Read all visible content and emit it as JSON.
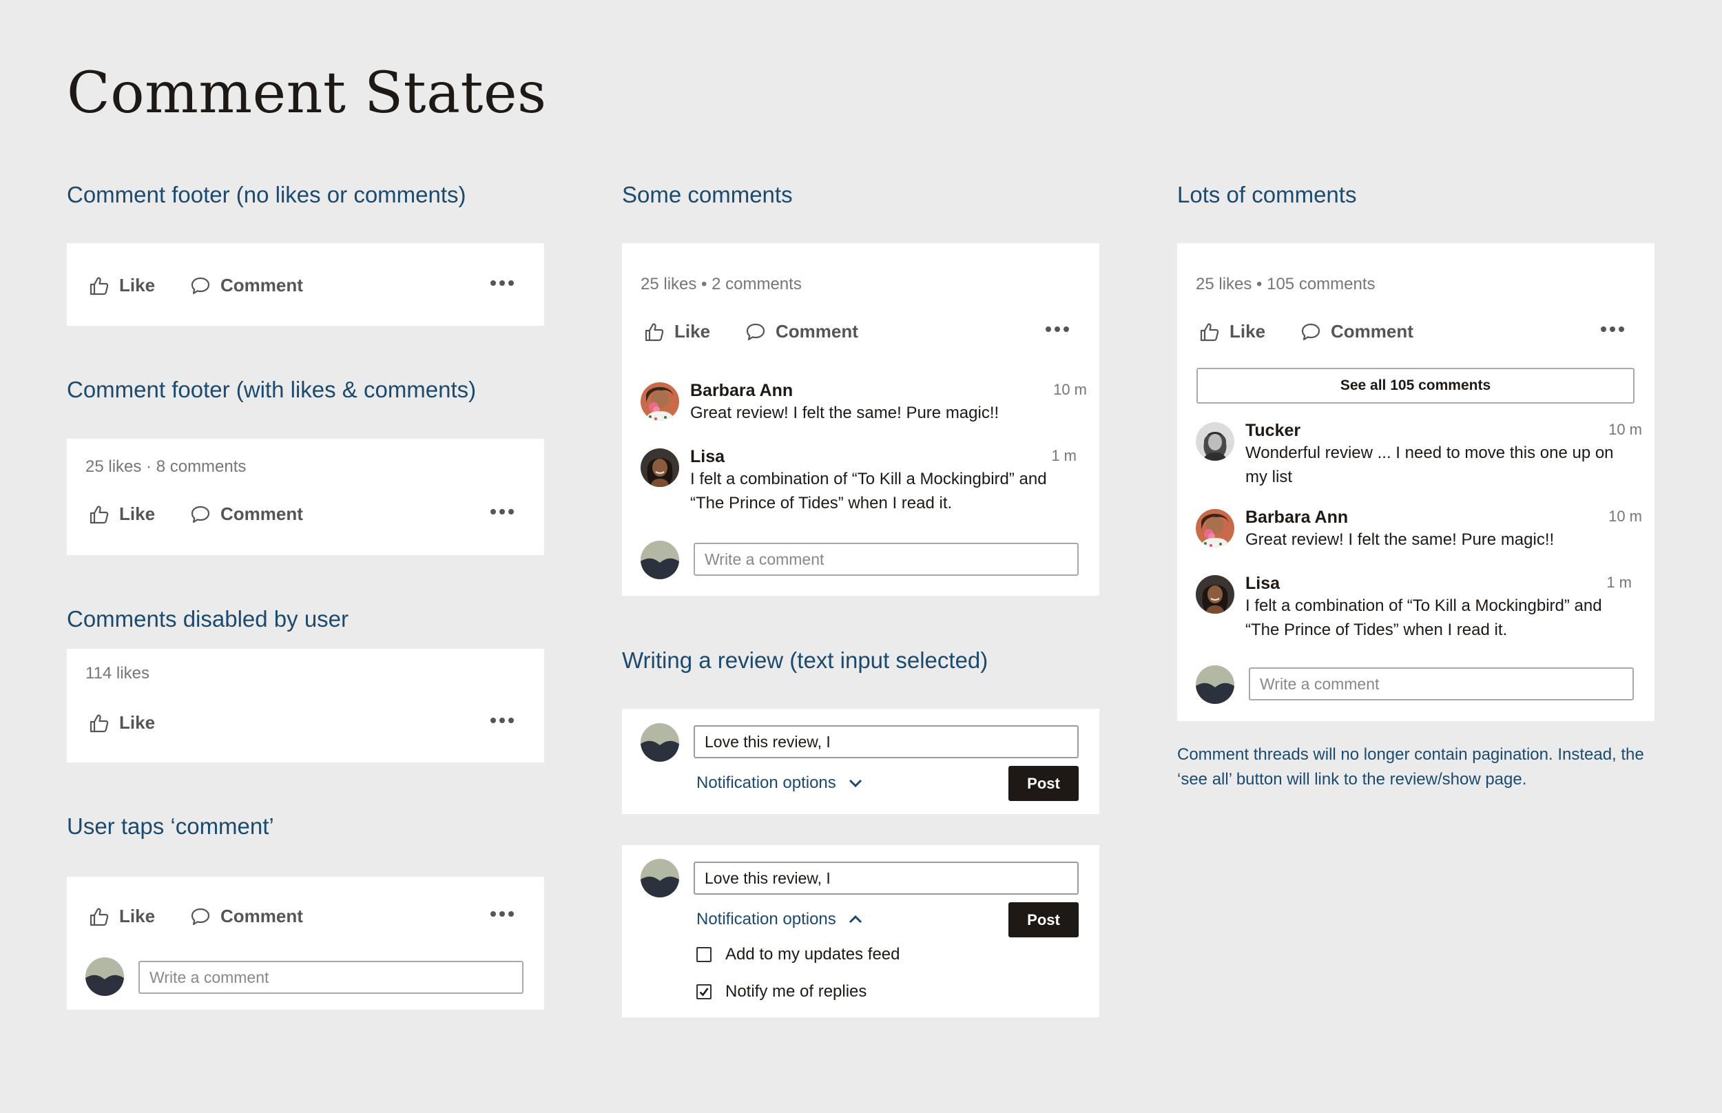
{
  "page": {
    "title": "Comment States"
  },
  "colors": {
    "background": "#ebebeb",
    "card": "#ffffff",
    "heading_blue": "#1c4a6e",
    "dark": "#1e1915",
    "muted": "#767676"
  },
  "icons": {
    "like": "thumbs-up-icon",
    "comment": "speech-bubble-icon",
    "more": "ellipsis-icon",
    "chevron_down": "chevron-down-icon",
    "chevron_up": "chevron-up-icon",
    "check": "checkmark-icon"
  },
  "actions": {
    "like_label": "Like",
    "comment_label": "Comment"
  },
  "input": {
    "placeholder": "Write a comment"
  },
  "sections": {
    "footer_empty": {
      "title": "Comment footer (no likes or comments)"
    },
    "footer_with": {
      "title": "Comment footer (with likes & comments)",
      "stats": "25 likes · 8 comments"
    },
    "disabled": {
      "title": "Comments disabled by user",
      "stats": "114 likes"
    },
    "taps_comment": {
      "title": "User taps ‘comment’"
    },
    "some": {
      "title": "Some comments",
      "stats": "25 likes • 2 comments",
      "comments": [
        {
          "name": "Barbara Ann",
          "time": "10 m",
          "text": "Great review! I felt the same! Pure magic!!"
        },
        {
          "name": "Lisa",
          "time": "1 m",
          "text": "I felt a combination of “To Kill a Mockingbird” and “The Prince of Tides” when I read it."
        }
      ]
    },
    "writing": {
      "title": "Writing a review (text input selected)",
      "input_value": "Love this review, I",
      "notification_label": "Notification options",
      "post_label": "Post",
      "options": [
        {
          "label": "Add to my updates feed",
          "checked": false
        },
        {
          "label": "Notify me of replies",
          "checked": true
        }
      ]
    },
    "lots": {
      "title": "Lots of comments",
      "stats": "25 likes • 105 comments",
      "see_all_label": "See all 105 comments",
      "comments": [
        {
          "name": "Tucker",
          "time": "10 m",
          "text": "Wonderful review ... I need to move this one up on my list"
        },
        {
          "name": "Barbara Ann",
          "time": "10 m",
          "text": "Great review! I felt the same! Pure magic!!"
        },
        {
          "name": "Lisa",
          "time": "1 m",
          "text": "I felt a combination of “To Kill a Mockingbird” and “The Prince of Tides” when I read it."
        }
      ],
      "note": "Comment threads will no longer contain pagination. Instead, the ‘see all’ button will link to the review/show page."
    }
  }
}
